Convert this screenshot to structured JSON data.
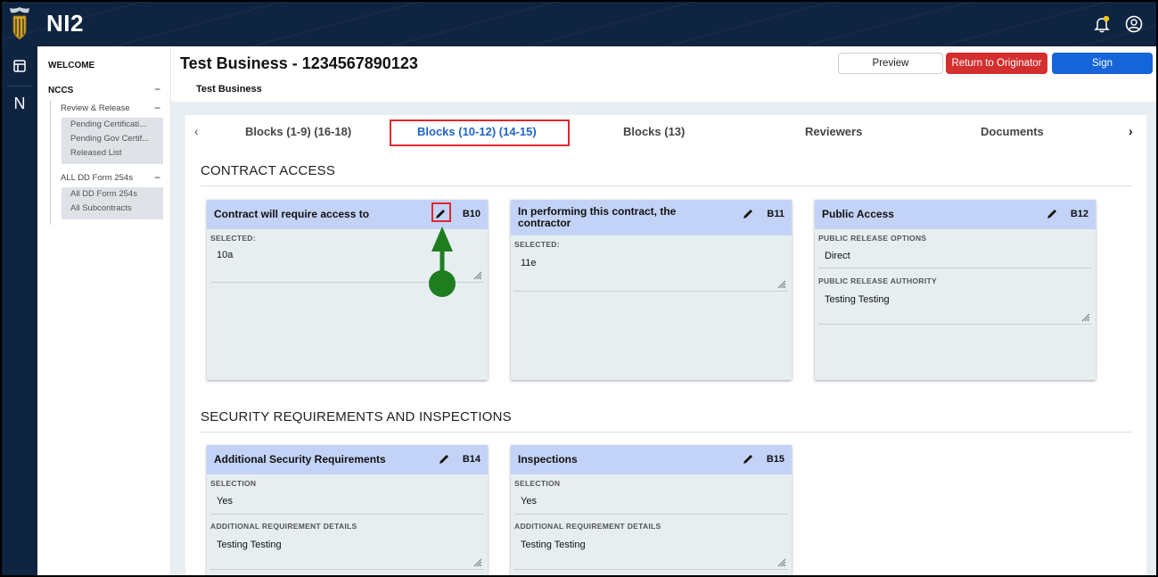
{
  "app": {
    "brand": "NI2"
  },
  "rail": {
    "item_n": "N"
  },
  "sidenav": {
    "welcome": "WELCOME",
    "nccs": "NCCS",
    "review_release": "Review & Release",
    "review_items": [
      "Pending Certificati...",
      "Pending Gov Certif...",
      "Released List"
    ],
    "all_forms": "ALL DD Form 254s",
    "form_items": [
      "All DD Form 254s",
      "All Subcontracts"
    ]
  },
  "header": {
    "title": "Test Business - 1234567890123",
    "subtitle": "Test Business",
    "preview": "Preview",
    "return": "Return to Originator",
    "sign": "Sign"
  },
  "tabs": {
    "items": [
      "Blocks (1-9) (16-18)",
      "Blocks (10-12) (14-15)",
      "Blocks (13)",
      "Reviewers",
      "Documents"
    ],
    "active": "Blocks (10-12) (14-15)"
  },
  "sections": {
    "contract_access": "CONTRACT ACCESS",
    "security": "SECURITY REQUIREMENTS AND INSPECTIONS"
  },
  "cards": {
    "b10": {
      "title": "Contract will require access to",
      "code": "B10",
      "label": "SELECTED:",
      "value": "10a"
    },
    "b11": {
      "title": "In performing this contract, the contractor",
      "code": "B11",
      "label": "SELECTED:",
      "value": "11e"
    },
    "b12": {
      "title": "Public Access",
      "code": "B12",
      "label1": "PUBLIC RELEASE OPTIONS",
      "value1": "Direct",
      "label2": "PUBLIC RELEASE AUTHORITY",
      "value2": "Testing Testing"
    },
    "b14": {
      "title": "Additional Security Requirements",
      "code": "B14",
      "label1": "SELECTION",
      "value1": "Yes",
      "label2": "ADDITIONAL REQUIREMENT DETAILS",
      "value2": "Testing Testing"
    },
    "b15": {
      "title": "Inspections",
      "code": "B15",
      "label1": "SELECTION",
      "value1": "Yes",
      "label2": "ADDITIONAL REQUIREMENT DETAILS",
      "value2": "Testing Testing"
    }
  },
  "colors": {
    "navy": "#0f2440",
    "accent_blue": "#1565d8",
    "danger_red": "#d32f2f",
    "card_header": "#c3d3f7",
    "annotation_green": "#1e7d1e"
  }
}
